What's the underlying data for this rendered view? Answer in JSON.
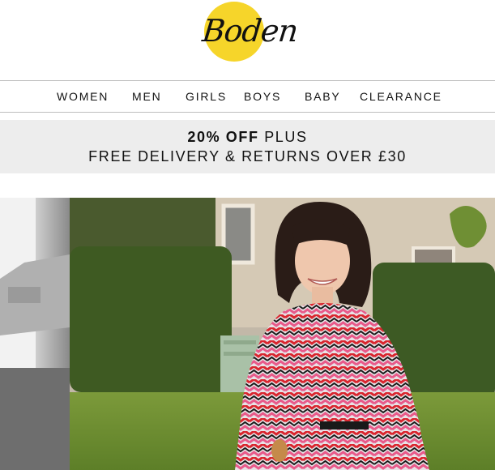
{
  "brand": {
    "logo_text": "Boden",
    "logo_color": "#f6d52a"
  },
  "nav": {
    "items": [
      {
        "label": "WOMEN"
      },
      {
        "label": "MEN"
      },
      {
        "label": "GIRLS"
      },
      {
        "label": "BOYS"
      },
      {
        "label": "BABY"
      },
      {
        "label": "CLEARANCE"
      }
    ]
  },
  "promo": {
    "highlight": "20% OFF",
    "plus": " PLUS",
    "line2": "FREE DELIVERY & RETURNS OVER £30",
    "background": "#ededed"
  },
  "hero": {
    "description_icon": "hero-photo-woman-in-zigzag-dress"
  }
}
